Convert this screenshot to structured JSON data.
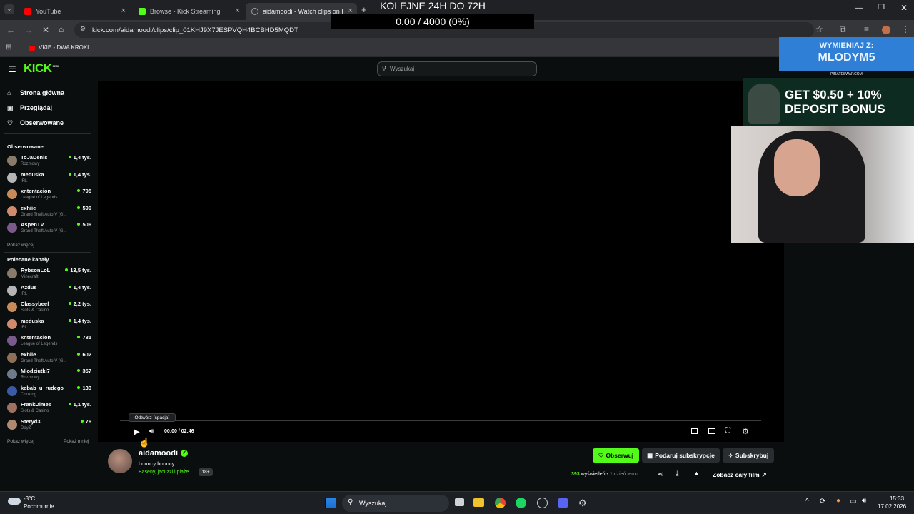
{
  "browser": {
    "tabs": [
      {
        "title": "YouTube"
      },
      {
        "title": "Browse - Kick Streaming"
      },
      {
        "title": "aidamoodi - Watch clips on Kick"
      }
    ],
    "new_tab": "+",
    "url": "kick.com/aidamoodi/clips/clip_01KHJ9X7JESPVQH4BCBHD5MQDT",
    "bookmark": "VKIE - DWA KROKI..."
  },
  "overlay": {
    "title": "KOLEJNE 24H DO 72H",
    "progress": "0.00 / 4000 (0%)"
  },
  "kick": {
    "logo": "KICK",
    "beta": "BETA",
    "search_placeholder": "Wyszukaj",
    "nav": [
      {
        "label": "Strona główna",
        "icon": "home-icon"
      },
      {
        "label": "Przeglądaj",
        "icon": "browse-icon"
      },
      {
        "label": "Obserwowane",
        "icon": "heart-icon"
      }
    ],
    "followed_heading": "Obserwowane",
    "followed": [
      {
        "name": "ToJaDenis",
        "category": "Rozmowy",
        "viewers": "1,4 tys."
      },
      {
        "name": "meduska",
        "category": "IRL",
        "viewers": "1,4 tys."
      },
      {
        "name": "xntentacion",
        "category": "League of Legends",
        "viewers": "795"
      },
      {
        "name": "exhiie",
        "category": "Grand Theft Auto V (G...",
        "viewers": "599"
      },
      {
        "name": "AspenTV",
        "category": "Grand Theft Auto V (G...",
        "viewers": "506"
      }
    ],
    "show_more": "Pokaż więcej",
    "recommended_heading": "Polecane kanały",
    "recommended": [
      {
        "name": "RybsonLoL",
        "category": "Minecraft",
        "viewers": "13,5 tys."
      },
      {
        "name": "Azdus",
        "category": "IRL",
        "viewers": "1,4 tys."
      },
      {
        "name": "Classybeef",
        "category": "Slots & Casino",
        "viewers": "2,2 tys."
      },
      {
        "name": "meduska",
        "category": "IRL",
        "viewers": "1,4 tys."
      },
      {
        "name": "xntentacion",
        "category": "League of Legends",
        "viewers": "781"
      },
      {
        "name": "exhiie",
        "category": "Grand Theft Auto V (G...",
        "viewers": "602"
      },
      {
        "name": "Mlodziutki7",
        "category": "Rozmowy",
        "viewers": "357"
      },
      {
        "name": "kebab_u_rudego",
        "category": "Cooking",
        "viewers": "133"
      },
      {
        "name": "FrankDimes",
        "category": "Slots & Casino",
        "viewers": "1,1 tys."
      },
      {
        "name": "Steryd3",
        "category": "DayZ",
        "viewers": "76"
      }
    ],
    "show_less": "Pokaż mniej",
    "player": {
      "tooltip": "Odtwórz (spacja)",
      "time": "00:00 / 02:46",
      "progress": 0
    },
    "clip": {
      "channel": "aidamoodi",
      "title": "bouncy bouncy",
      "category": "Baseny, jacuzzi i plaże",
      "age_badge": "18+",
      "follow": "Obserwuj",
      "gift": "Podaruj subskrypcje",
      "subscribe": "Subskrybuj",
      "views_count": "393",
      "views_label": "wyświetleń",
      "time_ago": "• 1 dzień temu",
      "full_video": "Zobacz cały film"
    },
    "accent": "#53fc18"
  },
  "ads": {
    "ad1_line1": "WYMIENIAJ Z:",
    "ad1_line2": "MLODYM5",
    "ad1_site": "PIRATESWAP.COM",
    "ad2_line1": "GET $0.50 + 10%",
    "ad2_line2": "DEPOSIT BONUS"
  },
  "taskbar": {
    "weather_temp": "-3°C",
    "weather_desc": "Pochmurnie",
    "search": "Wyszukaj",
    "time": "15:33",
    "date": "17.02.2026"
  }
}
